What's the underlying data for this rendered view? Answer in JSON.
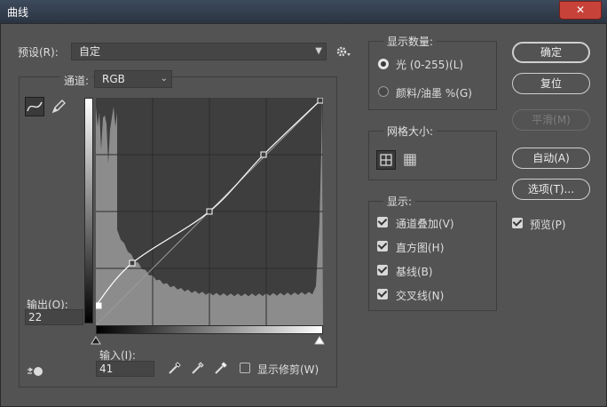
{
  "window": {
    "title": "曲线",
    "close_label": "✕"
  },
  "preset": {
    "label": "预设(R):",
    "value": "自定"
  },
  "channel": {
    "label": "通道:",
    "value": "RGB"
  },
  "output": {
    "label": "输出(O):",
    "value": "22"
  },
  "input": {
    "label": "输入(I):",
    "value": "41"
  },
  "show_clipping": {
    "label": "显示修剪(W)",
    "checked": false
  },
  "show_amount": {
    "title": "显示数量:",
    "options": [
      {
        "label": "光 (0-255)(L)",
        "selected": true
      },
      {
        "label": "颜料/油墨 %(G)",
        "selected": false
      }
    ]
  },
  "grid_size": {
    "title": "网格大小:"
  },
  "display": {
    "title": "显示:",
    "options": [
      {
        "label": "通道叠加(V)",
        "checked": true
      },
      {
        "label": "直方图(H)",
        "checked": true
      },
      {
        "label": "基线(B)",
        "checked": true
      },
      {
        "label": "交叉线(N)",
        "checked": true
      }
    ]
  },
  "buttons": {
    "ok": "确定",
    "reset": "复位",
    "smooth": "平滑(M)",
    "auto": "自动(A)",
    "options": "选项(T)..."
  },
  "preview": {
    "label": "预览(P)",
    "checked": true
  },
  "curve_points": [
    [
      0,
      22
    ],
    [
      41,
      70
    ],
    [
      128,
      128
    ],
    [
      189,
      192
    ],
    [
      255,
      255
    ]
  ],
  "colors": {
    "graph_bg": "#3e3e3e",
    "histogram": "#8c8c8c",
    "curve": "#ffffff",
    "close": "#c7433a"
  }
}
